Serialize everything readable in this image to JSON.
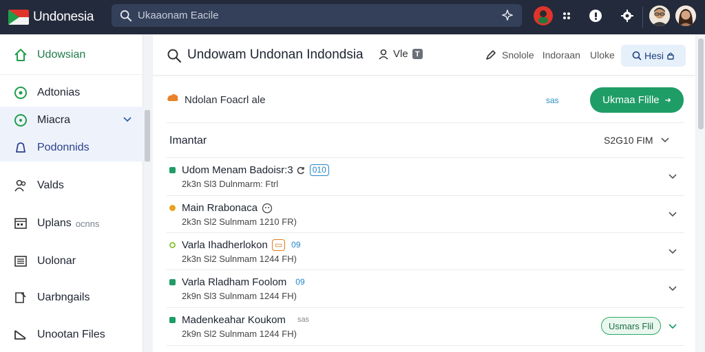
{
  "app": {
    "name": "Undonesia",
    "colors": {
      "topbar": "#232a3b",
      "accent_green": "#1f9d66",
      "flag_red": "#e0342a",
      "link_blue": "#2385c7"
    }
  },
  "search": {
    "placeholder": "Ukaaonam Eacile",
    "icon": "search-icon",
    "action_icon": "sparkle-icon"
  },
  "sidebar": {
    "items": [
      {
        "label": "Udowsian",
        "icon": "home-icon"
      },
      {
        "label": "Adtonias",
        "icon": "circle-target-icon"
      },
      {
        "label": "Miacra",
        "icon": "compass-icon"
      },
      {
        "label": "Podonnids",
        "icon": "bell-icon"
      },
      {
        "label": "Valds",
        "icon": "people-icon"
      },
      {
        "label": "Uplans",
        "sub": "ocnns",
        "icon": "calendar-icon"
      },
      {
        "label": "Uolonar",
        "icon": "list-icon"
      },
      {
        "label": "Uarbngails",
        "icon": "edit-icon"
      },
      {
        "label": "Unootan Files",
        "icon": "folder-icon"
      }
    ]
  },
  "main": {
    "header": {
      "title": "Undowam Undonan Indondsia",
      "user_label": "Vle",
      "user_badge": "T",
      "meta_1": "Snolole",
      "meta_2": "Indoraan",
      "meta_3": "Uloke",
      "button_label": "Hesi"
    },
    "sub": {
      "title": "Ndolan Foacrl ale",
      "link": "sas",
      "upload_label": "Ukmaa Flille"
    },
    "group": {
      "title": "Imantar",
      "meta": "S2G10 FIM"
    },
    "rows": [
      {
        "name": "Udom Menam Badoisr:3",
        "tag": "010",
        "desc": "2k3n Sl3 Dulnmarm: Ftrl",
        "dot_color": "#1f9d66"
      },
      {
        "name": "Main Rrabonaca",
        "tag": "",
        "desc": "2k3n Sl2 Sulnmam 1210 FR)",
        "dot_color": "#e8a21f"
      },
      {
        "name": "Varla Ihadherlokon",
        "tag": "09",
        "desc": "2k3n Sl2 Sulnmam 1244 FH)",
        "dot_color": "#8cc63f"
      },
      {
        "name": "Varla Rladham Foolom",
        "tag": "09",
        "desc": "2k9n Sl3 Sulnmam 1244 FH)",
        "dot_color": "#1f9d66"
      },
      {
        "name": "Madenkeahar Koukom",
        "tag": "sas",
        "desc": "2k9n Sl2 Sulnmam 1244 FH)",
        "dot_color": "#1f9d66",
        "status": "Usmars Flil"
      }
    ]
  }
}
